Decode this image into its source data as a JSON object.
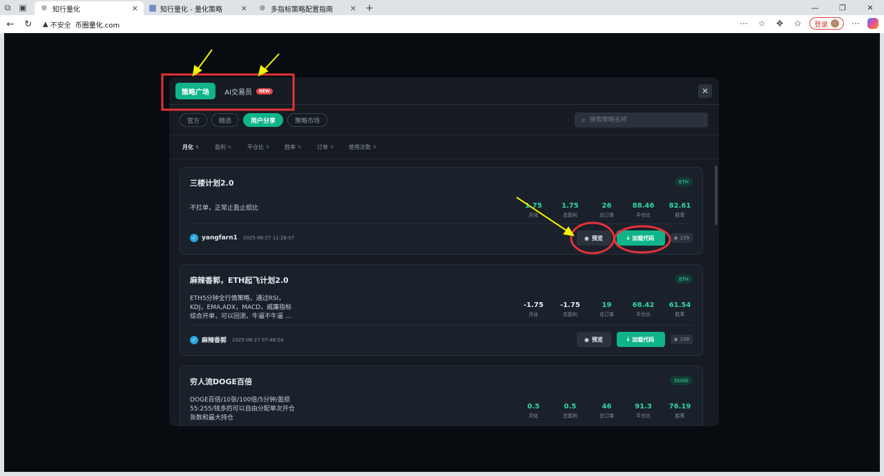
{
  "browser": {
    "tabs": [
      {
        "title": "知行量化",
        "active": true
      },
      {
        "title": "知行量化 - 量化策略",
        "active": false
      },
      {
        "title": "多指标策略配置指南",
        "active": false
      }
    ],
    "address": {
      "security_label": "不安全",
      "url": "币圈量化.com"
    },
    "login_label": "登录"
  },
  "modal": {
    "main_tabs": [
      {
        "label": "策略广场",
        "active": true
      },
      {
        "label": "AI交易员",
        "badge": "NEW",
        "active": false
      }
    ],
    "filters": [
      {
        "label": "官方",
        "active": false
      },
      {
        "label": "精选",
        "active": false
      },
      {
        "label": "用户分享",
        "active": true
      },
      {
        "label": "策略市场",
        "active": false
      }
    ],
    "search_placeholder": "搜索策略名称",
    "sort_options": [
      {
        "label": "月化",
        "active": true
      },
      {
        "label": "盈利",
        "active": false
      },
      {
        "label": "平仓比",
        "active": false
      },
      {
        "label": "胜率",
        "active": false
      },
      {
        "label": "订单",
        "active": false
      },
      {
        "label": "使用次数",
        "active": false
      }
    ],
    "preview_label": "预览",
    "load_label": "加载代码",
    "strategies": [
      {
        "title": "三楼计划2.0",
        "coin": "ETH",
        "desc_lines": [
          "不扛单，正常止盈止损比"
        ],
        "stats": [
          {
            "value": "1.75",
            "label": "月化"
          },
          {
            "value": "1.75",
            "label": "总盈利"
          },
          {
            "value": "26",
            "label": "总订单"
          },
          {
            "value": "88.46",
            "label": "平仓比"
          },
          {
            "value": "82.61",
            "label": "胜率"
          }
        ],
        "author": "yangfarn1",
        "time": "2025-08-27 11:28:07",
        "views": "239"
      },
      {
        "title": "麻辣香郭，ETH起飞计划2.0",
        "coin": "ETH",
        "desc_lines": [
          "ETH5分钟全行情策略，通过RSI，",
          "KDJ，EMA,ADX，MACD，威廉指标",
          "综合开单，可以回测，牛逼不牛逼 ..."
        ],
        "stats": [
          {
            "value": "-1.75",
            "label": "月化"
          },
          {
            "value": "-1.75",
            "label": "总盈利"
          },
          {
            "value": "19",
            "label": "总订单"
          },
          {
            "value": "68.42",
            "label": "平仓比"
          },
          {
            "value": "61.54",
            "label": "胜率"
          }
        ],
        "author": "麻辣香郭",
        "time": "2025-08-27 07:48:54",
        "views": "108"
      },
      {
        "title": "穷人流DOGE百倍",
        "coin": "DOGE",
        "desc_lines": [
          "DOGE百倍/10张/100倍/5分钟/盈损",
          "55:255/钱多的可以自由分配单次开仓",
          "张数和最大持仓"
        ],
        "stats": [
          {
            "value": "0.5",
            "label": "月化"
          },
          {
            "value": "0.5",
            "label": "总盈利"
          },
          {
            "value": "46",
            "label": "总订单"
          },
          {
            "value": "91.3",
            "label": "平仓比"
          },
          {
            "value": "76.19",
            "label": "胜率"
          }
        ]
      }
    ]
  },
  "colors": {
    "accent": "#10b48a",
    "annotation_red": "#e5333a",
    "annotation_yellow": "#f5f500"
  }
}
